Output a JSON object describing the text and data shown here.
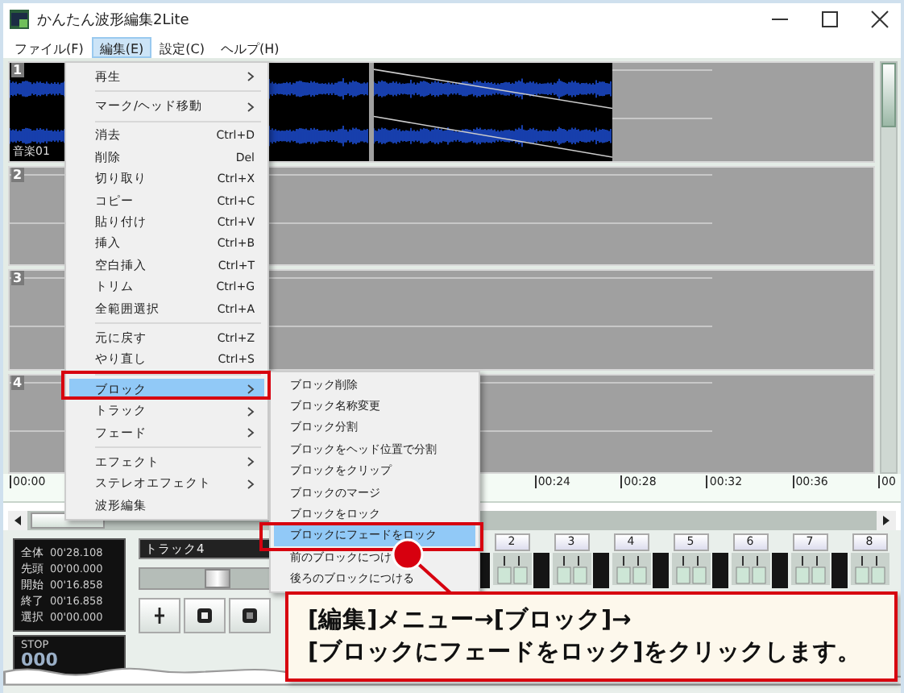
{
  "window": {
    "title": "かんたん波形編集2Lite"
  },
  "menu_bar": [
    {
      "label": "ファイル(F)",
      "selected": false
    },
    {
      "label": "編集(E)",
      "selected": true
    },
    {
      "label": "設定(C)",
      "selected": false
    },
    {
      "label": "ヘルプ(H)",
      "selected": false
    }
  ],
  "tracks": [
    {
      "number": "1",
      "name": "音楽01",
      "blocks": [
        {
          "fade_out": false
        },
        {
          "fade_out": true
        }
      ]
    },
    {
      "number": "2"
    },
    {
      "number": "3"
    },
    {
      "number": "4"
    }
  ],
  "ruler": {
    "first": "00:00",
    "labels": [
      "00:24",
      "00:28",
      "00:32",
      "00:36",
      "00"
    ]
  },
  "counter": [
    {
      "label": "全体",
      "value": "00'28.108"
    },
    {
      "label": "先頭",
      "value": "00'00.000"
    },
    {
      "label": "開始",
      "value": "00'16.858"
    },
    {
      "label": "終了",
      "value": "00'16.858"
    },
    {
      "label": "選択",
      "value": "00'00.000"
    }
  ],
  "transport": {
    "status": "STOP",
    "time": "000"
  },
  "track_name": "トラック4",
  "volume": {
    "level": 0.6
  },
  "mixer_channels": [
    "2",
    "3",
    "4",
    "5",
    "6",
    "7",
    "8"
  ],
  "edit_menu": [
    {
      "kind": "submenu",
      "label": "再生",
      "selected": false
    },
    {
      "kind": "separator"
    },
    {
      "kind": "submenu",
      "label": "マーク/ヘッド移動",
      "selected": false
    },
    {
      "kind": "separator"
    },
    {
      "kind": "command",
      "label": "消去",
      "shortcut": "Ctrl+D",
      "selected": false
    },
    {
      "kind": "command",
      "label": "削除",
      "shortcut": "Del",
      "selected": false
    },
    {
      "kind": "command",
      "label": "切り取り",
      "shortcut": "Ctrl+X",
      "selected": false
    },
    {
      "kind": "command",
      "label": "コピー",
      "shortcut": "Ctrl+C",
      "selected": false
    },
    {
      "kind": "command",
      "label": "貼り付け",
      "shortcut": "Ctrl+V",
      "selected": false
    },
    {
      "kind": "command",
      "label": "挿入",
      "shortcut": "Ctrl+B",
      "selected": false
    },
    {
      "kind": "command",
      "label": "空白挿入",
      "shortcut": "Ctrl+T",
      "selected": false
    },
    {
      "kind": "command",
      "label": "トリム",
      "shortcut": "Ctrl+G",
      "selected": false
    },
    {
      "kind": "command",
      "label": "全範囲選択",
      "shortcut": "Ctrl+A",
      "selected": false
    },
    {
      "kind": "separator"
    },
    {
      "kind": "command",
      "label": "元に戻す",
      "shortcut": "Ctrl+Z",
      "selected": false
    },
    {
      "kind": "command",
      "label": "やり直し",
      "shortcut": "Ctrl+S",
      "selected": false
    },
    {
      "kind": "separator"
    },
    {
      "kind": "submenu",
      "label": "ブロック",
      "selected": true
    },
    {
      "kind": "submenu",
      "label": "トラック",
      "selected": false
    },
    {
      "kind": "submenu",
      "label": "フェード",
      "selected": false
    },
    {
      "kind": "separator"
    },
    {
      "kind": "submenu",
      "label": "エフェクト",
      "selected": false
    },
    {
      "kind": "submenu",
      "label": "ステレオエフェクト",
      "selected": false
    },
    {
      "kind": "command",
      "label": "波形編集",
      "selected": false
    }
  ],
  "block_submenu": [
    {
      "label": "ブロック削除",
      "selected": false
    },
    {
      "label": "ブロック名称変更",
      "selected": false
    },
    {
      "label": "ブロック分割",
      "selected": false
    },
    {
      "label": "ブロックをヘッド位置で分割",
      "selected": false
    },
    {
      "label": "ブロックをクリップ",
      "selected": false
    },
    {
      "label": "ブロックのマージ",
      "selected": false
    },
    {
      "label": "ブロックをロック",
      "selected": false
    },
    {
      "label": "ブロックにフェードをロック",
      "selected": true
    },
    {
      "label": "前のブロックにつけ",
      "selected": false
    },
    {
      "label": "後ろのブロックにつける",
      "selected": false
    }
  ],
  "callout": {
    "lines": [
      "[編集]メニュー→[ブロック]→",
      "[ブロックにフェードをロック]をクリックします。"
    ]
  }
}
